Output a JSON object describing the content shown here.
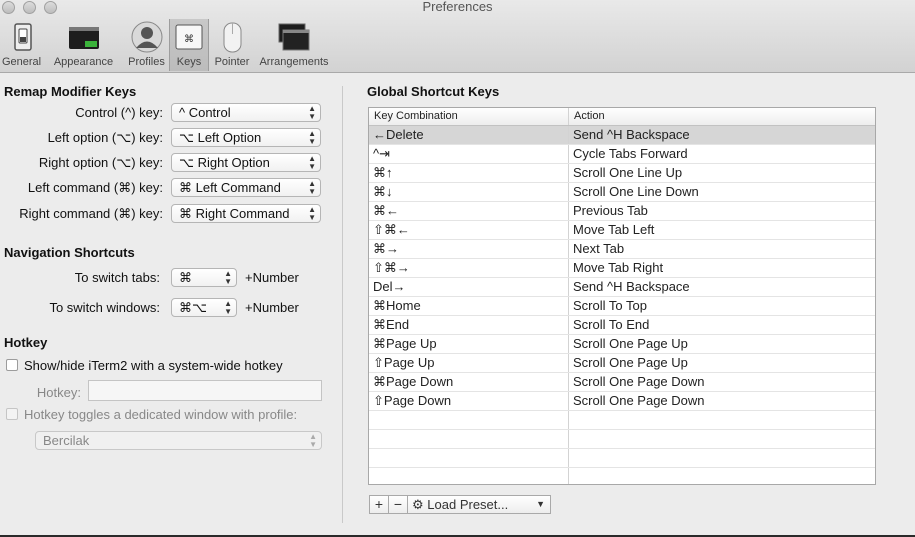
{
  "window": {
    "title": "Preferences"
  },
  "toolbar": {
    "items": [
      {
        "label": "General",
        "icon": "switch-icon"
      },
      {
        "label": "Appearance",
        "icon": "terminal-window-icon"
      },
      {
        "label": "Profiles",
        "icon": "user-silhouette-icon"
      },
      {
        "label": "Keys",
        "icon": "command-key-icon",
        "selected": true
      },
      {
        "label": "Pointer",
        "icon": "mouse-icon"
      },
      {
        "label": "Arrangements",
        "icon": "stacked-windows-icon"
      }
    ]
  },
  "remap": {
    "title": "Remap Modifier Keys",
    "rows": [
      {
        "label": "Control (^) key:",
        "value": "^ Control"
      },
      {
        "label": "Left option (⌥) key:",
        "value": "⌥ Left Option"
      },
      {
        "label": "Right option (⌥) key:",
        "value": "⌥ Right Option"
      },
      {
        "label": "Left command (⌘) key:",
        "value": "⌘ Left Command"
      },
      {
        "label": "Right command (⌘) key:",
        "value": "⌘ Right Command"
      }
    ]
  },
  "navigation": {
    "title": "Navigation Shortcuts",
    "tabs_label": "To switch tabs:",
    "tabs_value": "⌘",
    "windows_label": "To switch windows:",
    "windows_value": "⌘⌥",
    "suffix": "+Number"
  },
  "hotkey": {
    "title": "Hotkey",
    "show_hide_label": "Show/hide iTerm2 with a system-wide hotkey",
    "hotkey_label": "Hotkey:",
    "hotkey_value": "",
    "dedicated_label": "Hotkey toggles a dedicated window with profile:",
    "profile_value": "Bercilak"
  },
  "global": {
    "title": "Global Shortcut Keys",
    "columns": [
      "Key Combination",
      "Action"
    ],
    "rows": [
      {
        "key": "←Delete",
        "action": "Send ^H Backspace"
      },
      {
        "key": "^⇥",
        "action": "Cycle Tabs Forward"
      },
      {
        "key": "⌘↑",
        "action": "Scroll One Line Up"
      },
      {
        "key": "⌘↓",
        "action": "Scroll One Line Down"
      },
      {
        "key": "⌘←",
        "action": "Previous Tab"
      },
      {
        "key": "⇧⌘←",
        "action": "Move Tab Left"
      },
      {
        "key": "⌘→",
        "action": "Next Tab"
      },
      {
        "key": "⇧⌘→",
        "action": "Move Tab Right"
      },
      {
        "key": "Del→",
        "action": "Send ^H Backspace"
      },
      {
        "key": "⌘Home",
        "action": "Scroll To Top"
      },
      {
        "key": "⌘End",
        "action": "Scroll To End"
      },
      {
        "key": "⌘Page Up",
        "action": "Scroll One Page Up"
      },
      {
        "key": "⇧Page Up",
        "action": "Scroll One Page Up"
      },
      {
        "key": "⌘Page Down",
        "action": "Scroll One Page Down"
      },
      {
        "key": "⇧Page Down",
        "action": "Scroll One Page Down"
      }
    ],
    "add_label": "+",
    "remove_label": "−",
    "preset_label": "Load Preset..."
  }
}
